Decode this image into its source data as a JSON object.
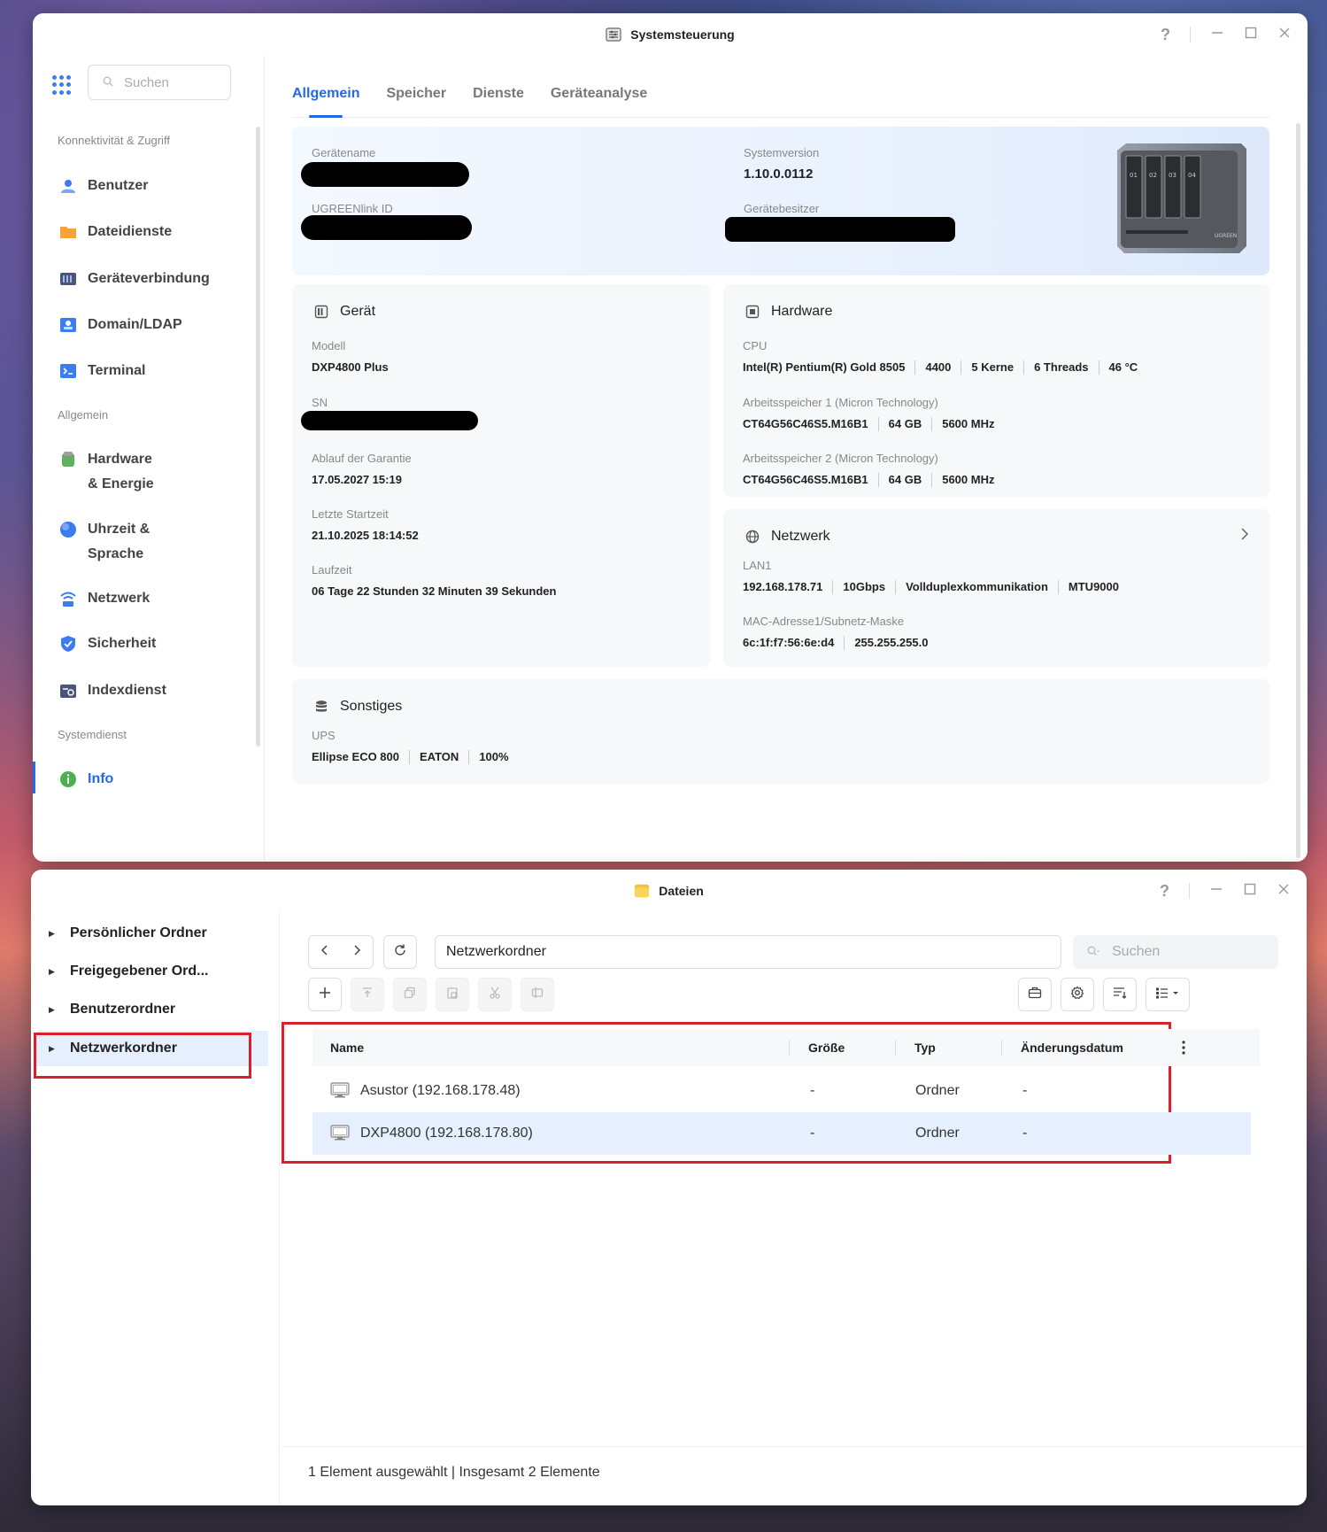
{
  "sys": {
    "title": "Systemsteuerung",
    "help": "?",
    "search_placeholder": "Suchen",
    "sections": [
      {
        "title": "Konnektivität & Zugriff"
      },
      {
        "title": "Allgemein"
      },
      {
        "title": "Systemdienst"
      }
    ],
    "nav": [
      {
        "label": "Benutzer"
      },
      {
        "label": "Dateidienste"
      },
      {
        "label": "Geräteverbindung"
      },
      {
        "label": "Domain/LDAP"
      },
      {
        "label": "Terminal"
      },
      {
        "label": "Hardware & Energie"
      },
      {
        "label": "Uhrzeit & Sprache"
      },
      {
        "label": "Netzwerk"
      },
      {
        "label": "Sicherheit"
      },
      {
        "label": "Indexdienst"
      },
      {
        "label": "Info"
      }
    ],
    "tabs": [
      "Allgemein",
      "Speicher",
      "Dienste",
      "Geräteanalyse"
    ],
    "hero": {
      "device_name_label": "Gerätename",
      "ugreenlink_label": "UGREENlink ID",
      "sysver_label": "Systemversion",
      "sysver_value": "1.10.0.0112",
      "owner_label": "Gerätebesitzer"
    },
    "device": {
      "title": "Gerät",
      "model_label": "Modell",
      "model_value": "DXP4800 Plus",
      "sn_label": "SN",
      "warranty_label": "Ablauf der Garantie",
      "warranty_value": "17.05.2027 15:19",
      "boot_label": "Letzte Startzeit",
      "boot_value": "21.10.2025 18:14:52",
      "uptime_label": "Laufzeit",
      "uptime_value": "06 Tage 22 Stunden 32 Minuten 39 Sekunden"
    },
    "hardware": {
      "title": "Hardware",
      "cpu_label": "CPU",
      "cpu_parts": [
        "Intel(R) Pentium(R) Gold 8505",
        "4400",
        "5 Kerne",
        "6 Threads",
        "46 °C"
      ],
      "ram1_label": "Arbeitsspeicher 1 (Micron Technology)",
      "ram1_parts": [
        "CT64G56C46S5.M16B1",
        "64 GB",
        "5600 MHz"
      ],
      "ram2_label": "Arbeitsspeicher 2 (Micron Technology)",
      "ram2_parts": [
        "CT64G56C46S5.M16B1",
        "64 GB",
        "5600 MHz"
      ]
    },
    "network": {
      "title": "Netzwerk",
      "lan_label": "LAN1",
      "lan_parts": [
        "192.168.178.71",
        "10Gbps",
        "Vollduplexkommunikation",
        "MTU9000"
      ],
      "mac_label": "MAC-Adresse1/Subnetz-Maske",
      "mac_parts": [
        "6c:1f:f7:56:6e:d4",
        "255.255.255.0"
      ]
    },
    "misc": {
      "title": "Sonstiges",
      "ups_label": "UPS",
      "ups_parts": [
        "Ellipse ECO 800",
        "EATON",
        "100%"
      ]
    },
    "device_image_labels": [
      "01",
      "02",
      "03",
      "04",
      "UGREEN"
    ]
  },
  "files": {
    "title": "Dateien",
    "help": "?",
    "tree": [
      {
        "label": "Persönlicher Ordner"
      },
      {
        "label": "Freigegebener Ord..."
      },
      {
        "label": "Benutzerordner"
      },
      {
        "label": "Netzwerkordner"
      }
    ],
    "path": "Netzwerkordner",
    "search_placeholder": "Suchen",
    "columns": [
      "Name",
      "Größe",
      "Typ",
      "Änderungsdatum"
    ],
    "rows": [
      {
        "name": "Asustor (192.168.178.48)",
        "size": "-",
        "type": "Ordner",
        "date": "-"
      },
      {
        "name": "DXP4800 (192.168.178.80)",
        "size": "-",
        "type": "Ordner",
        "date": "-"
      }
    ],
    "status": "1 Element ausgewählt | Insgesamt 2 Elemente"
  },
  "colors": {
    "accent": "#2469e6",
    "highlight_box": "#d9212c",
    "selection": "#e6effd"
  }
}
